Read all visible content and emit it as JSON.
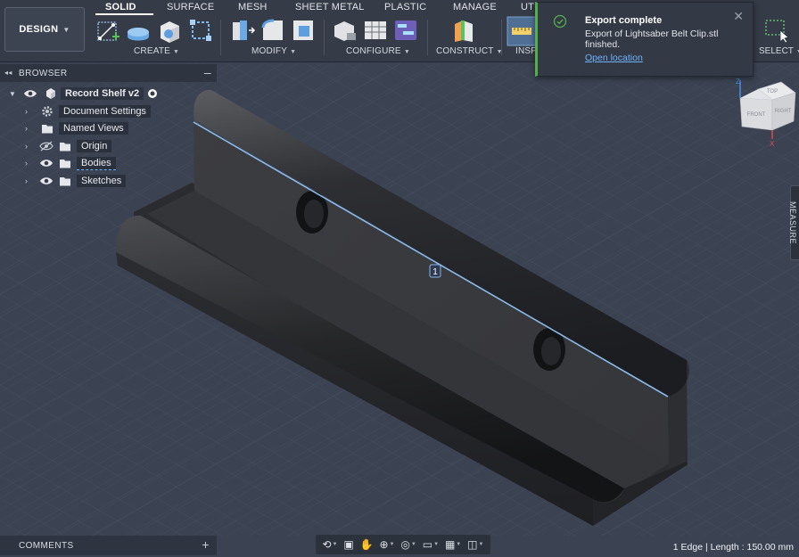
{
  "workspace": {
    "label": "DESIGN"
  },
  "tabs": [
    {
      "label": "SOLID",
      "active": true
    },
    {
      "label": "SURFACE"
    },
    {
      "label": "MESH"
    },
    {
      "label": "SHEET METAL"
    },
    {
      "label": "PLASTIC"
    },
    {
      "label": "MANAGE"
    },
    {
      "label": "UTI"
    }
  ],
  "groups": {
    "create": "CREATE",
    "modify": "MODIFY",
    "configure": "CONFIGURE",
    "construct": "CONSTRUCT",
    "inspect": "INSP",
    "select": "SELECT"
  },
  "browser": {
    "title": "BROWSER",
    "root": "Record Shelf v2",
    "items": [
      {
        "label": "Document Settings",
        "icon": "gear-icon"
      },
      {
        "label": "Named Views",
        "icon": "folder-icon"
      },
      {
        "label": "Origin",
        "icon": "folder-icon",
        "hidden": true
      },
      {
        "label": "Bodies",
        "icon": "folder-icon"
      },
      {
        "label": "Sketches",
        "icon": "folder-icon"
      }
    ]
  },
  "toast": {
    "title": "Export complete",
    "message": "Export of Lightsaber Belt Clip.stl finished.",
    "link": "Open location"
  },
  "viewport": {
    "edge_marker": "1",
    "axes": {
      "z": "Z",
      "x": "X"
    },
    "viewcube_faces": {
      "top": "TOP",
      "front": "FRONT",
      "right": "RIGHT"
    }
  },
  "side_panel": {
    "measure": "MEASURE"
  },
  "comments": {
    "title": "COMMENTS"
  },
  "status": {
    "text": "1 Edge | Length : 150.00 mm"
  },
  "colors": {
    "accent_blue": "#6fb2ff",
    "success_green": "#52b04a",
    "selected_edge": "#8ab8e8"
  }
}
